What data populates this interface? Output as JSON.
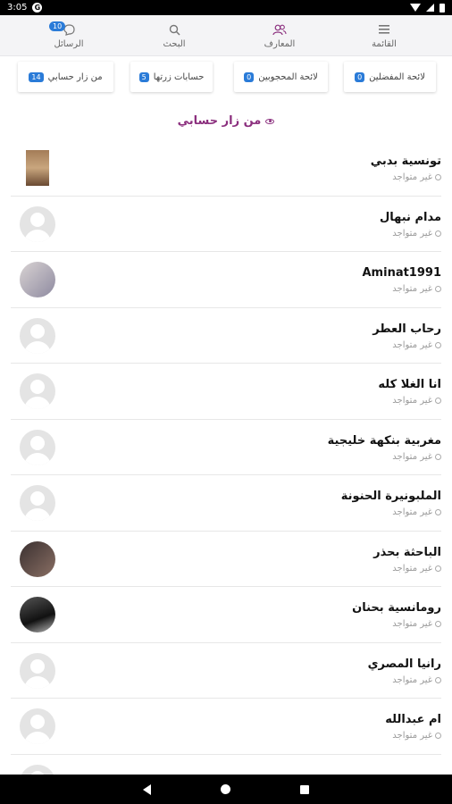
{
  "status_bar": {
    "time": "3:05",
    "app_icon": "G"
  },
  "nav": {
    "menu_label": "القائمة",
    "friends_label": "المعارف",
    "search_label": "البحث",
    "messages_label": "الرسائل",
    "messages_badge": "10"
  },
  "filters": [
    {
      "label": "لائحة المفضلين",
      "count": "0"
    },
    {
      "label": "لائحة المحجوبين",
      "count": "0"
    },
    {
      "label": "حسابات زرتها",
      "count": "5"
    },
    {
      "label": "من زار حسابي",
      "count": "14"
    }
  ],
  "section_title": "من زار حسابي",
  "visitors": [
    {
      "name": "تونسية بدبي",
      "status": "غير متواجد"
    },
    {
      "name": "مدام نبهال",
      "status": "غير متواجد"
    },
    {
      "name": "Aminat1991",
      "status": "غير متواجد"
    },
    {
      "name": "رحاب العطر",
      "status": "غير متواجد"
    },
    {
      "name": "انا الغلا كله",
      "status": "غير متواجد"
    },
    {
      "name": "مغربية بنكهة خليجية",
      "status": "غير متواجد"
    },
    {
      "name": "الملبونيرة الحنونة",
      "status": "غير متواجد"
    },
    {
      "name": "الباحثة بحذر",
      "status": "غير متواجد"
    },
    {
      "name": "رومانسية بحنان",
      "status": "غير متواجد"
    },
    {
      "name": "رانيا المصري",
      "status": "غير متواجد"
    },
    {
      "name": "ام عبدالله",
      "status": "غير متواجد"
    }
  ],
  "colors": {
    "accent": "#8b2f7e",
    "badge": "#2a7bd8"
  }
}
